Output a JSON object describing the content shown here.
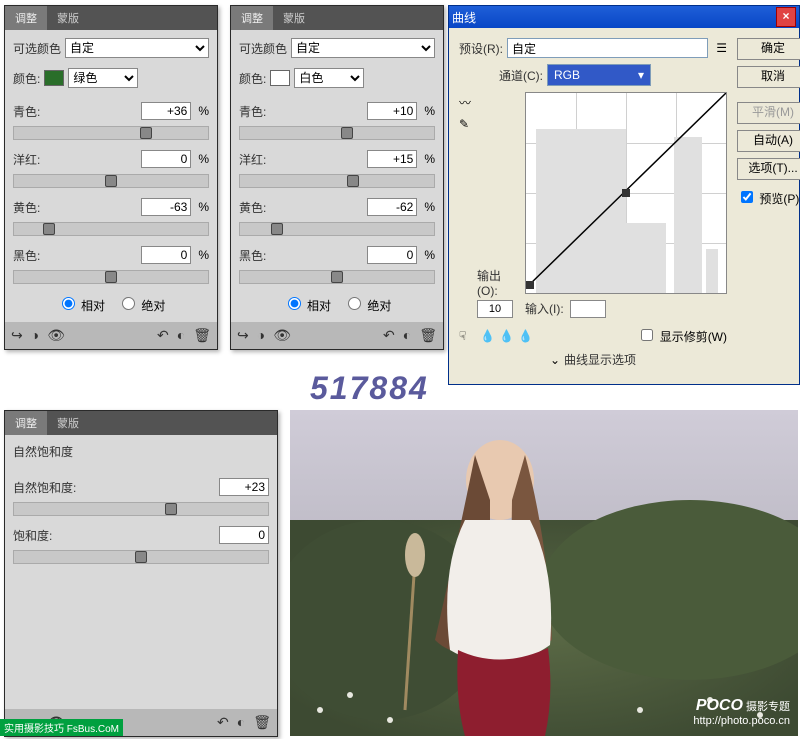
{
  "tabs": {
    "adj": "调整",
    "mask": "蒙版"
  },
  "watermark": "517884",
  "credit": "实用摄影技巧 FsBus.CoM",
  "poco": {
    "brand": "POCO",
    "sub": "摄影专题",
    "url": "http://photo.poco.cn"
  },
  "p1": {
    "title": "可选颜色",
    "preset_label": "自定",
    "color_label": "颜色:",
    "color_name": "绿色",
    "cyan": "青色:",
    "cyan_v": "+36",
    "mag": "洋红:",
    "mag_v": "0",
    "yel": "黄色:",
    "yel_v": "-63",
    "blk": "黑色:",
    "blk_v": "0",
    "rel": "相对",
    "abs": "绝对",
    "pct": "%"
  },
  "p2": {
    "title": "可选颜色",
    "preset_label": "自定",
    "color_label": "颜色:",
    "color_name": "白色",
    "cyan": "青色:",
    "cyan_v": "+10",
    "mag": "洋红:",
    "mag_v": "+15",
    "yel": "黄色:",
    "yel_v": "-62",
    "blk": "黑色:",
    "blk_v": "0",
    "rel": "相对",
    "abs": "绝对",
    "pct": "%"
  },
  "p3": {
    "title": "自然饱和度",
    "vib": "自然饱和度:",
    "vib_v": "+23",
    "sat": "饱和度:",
    "sat_v": "0"
  },
  "curves": {
    "winTitle": "曲线",
    "preset": "预设(R):",
    "preset_v": "自定",
    "channel": "通道(C):",
    "channel_v": "RGB",
    "output": "输出(O):",
    "output_v": "10",
    "input": "输入(I):",
    "input_v": "",
    "show": "显示修剪(W)",
    "disp": "曲线显示选项",
    "ok": "确定",
    "cancel": "取消",
    "smooth": "平滑(M)",
    "auto": "自动(A)",
    "options": "选项(T)...",
    "preview": "预览(P)"
  }
}
